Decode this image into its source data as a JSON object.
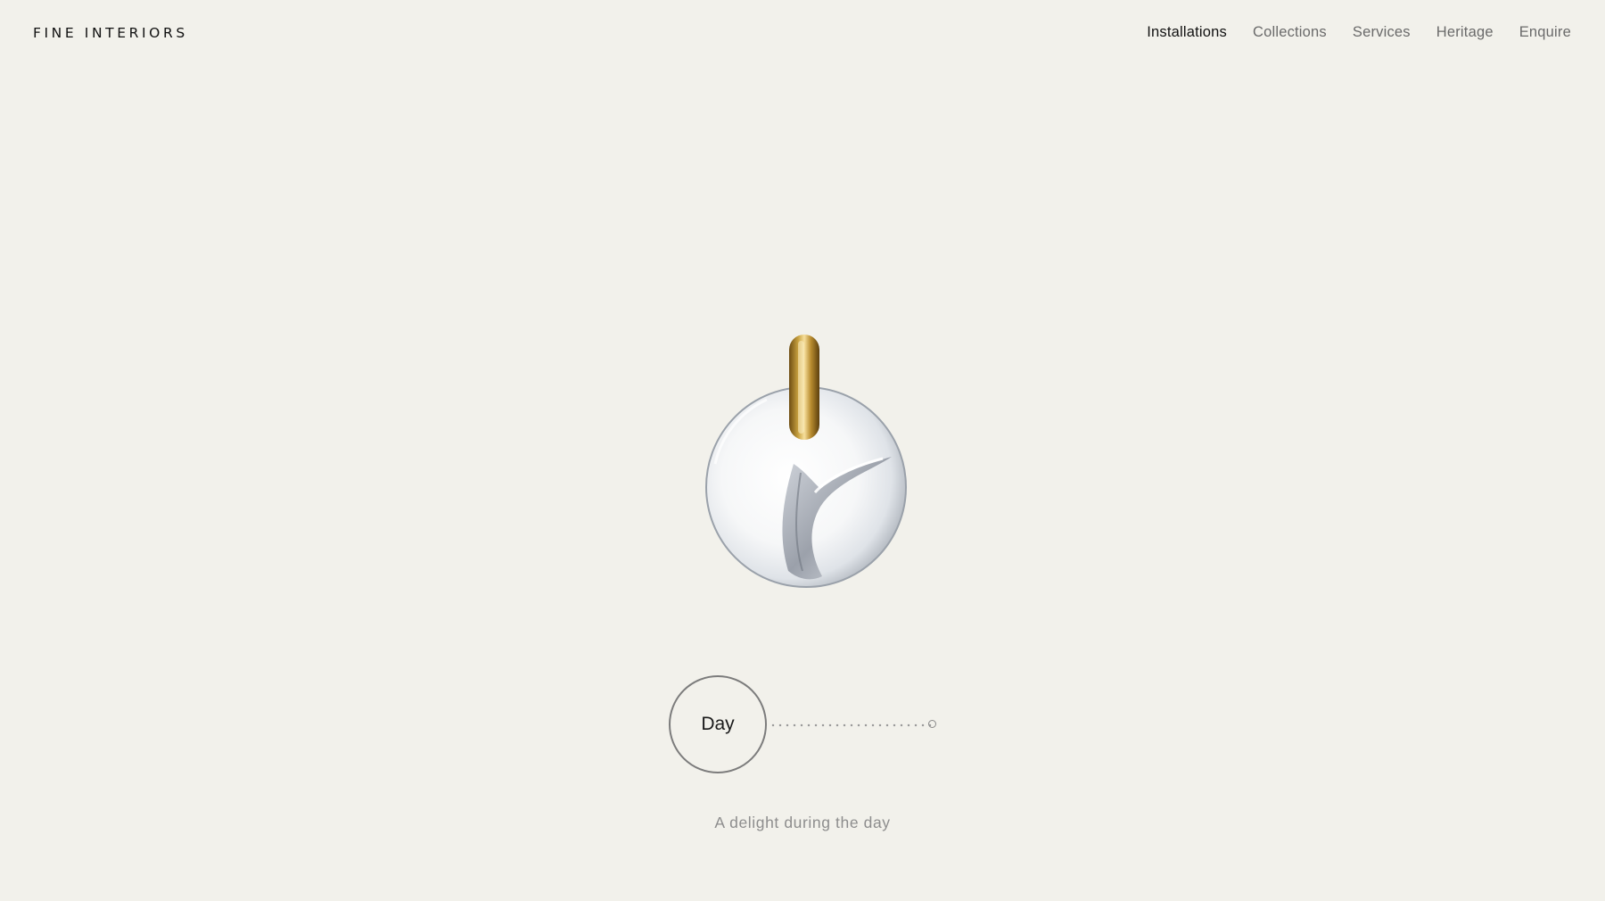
{
  "brand": {
    "logo_text": "FINE INTERIORS"
  },
  "nav": {
    "items": [
      {
        "label": "Installations",
        "active": true
      },
      {
        "label": "Collections",
        "active": false
      },
      {
        "label": "Services",
        "active": false
      },
      {
        "label": "Heritage",
        "active": false
      },
      {
        "label": "Enquire",
        "active": false
      }
    ]
  },
  "mode_toggle": {
    "current_label": "Day"
  },
  "caption": {
    "text": "A delight during the day"
  },
  "colors": {
    "background": "#f2f1eb",
    "active_nav": "#111111",
    "inactive_nav": "#6a6a6a",
    "brass": "#c9a240"
  }
}
